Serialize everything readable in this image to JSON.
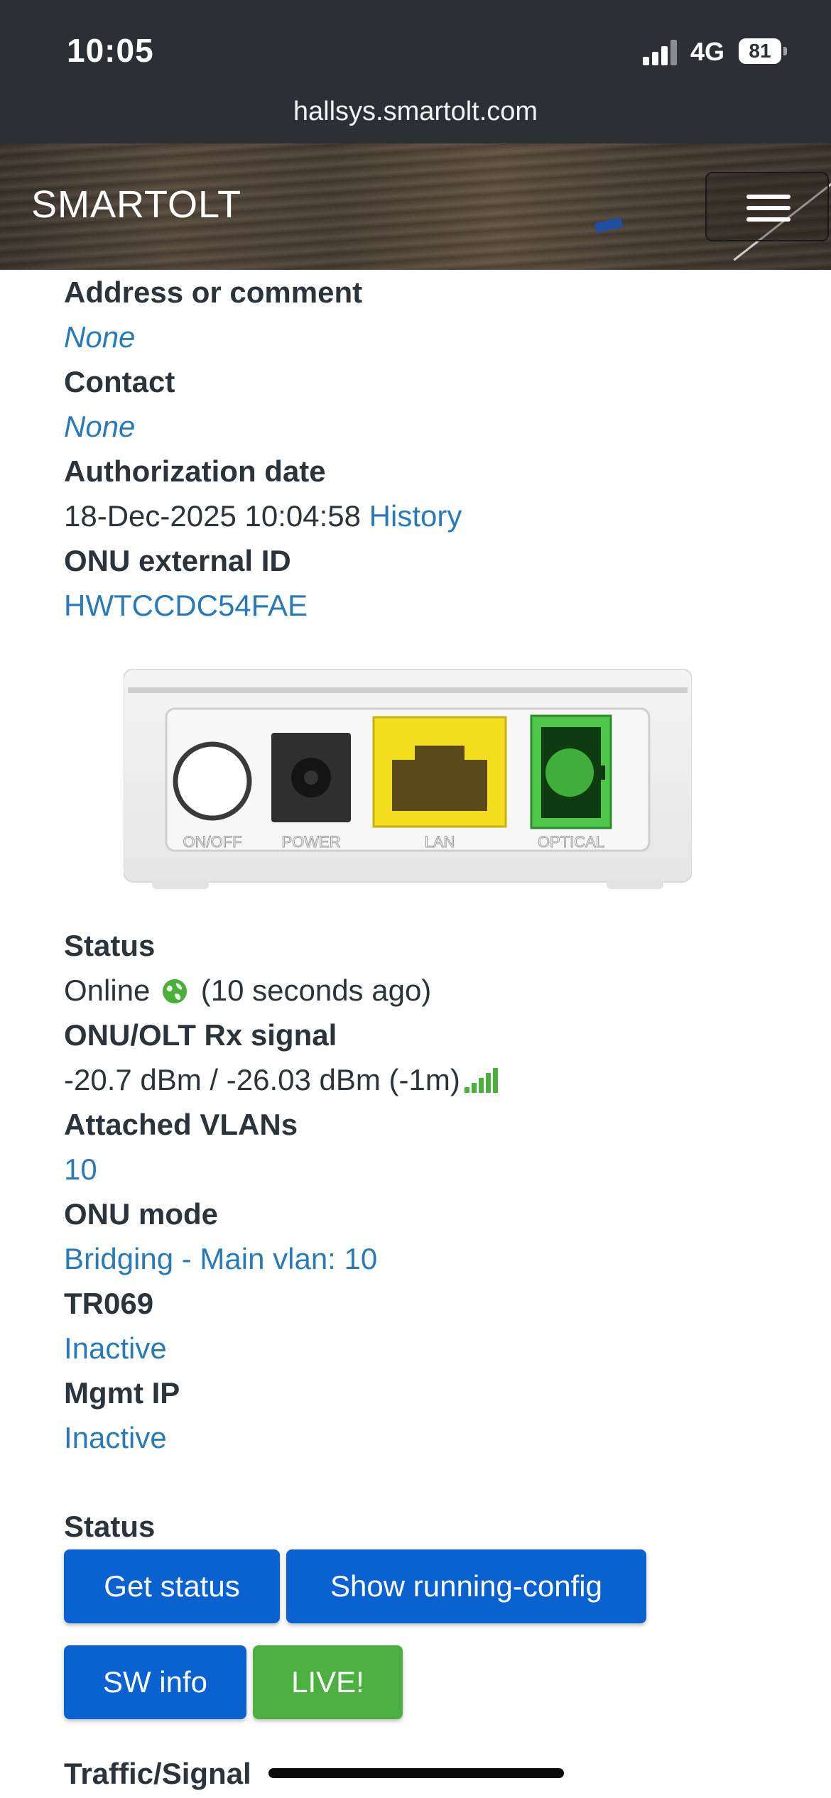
{
  "status_bar": {
    "time": "10:05",
    "network": "4G",
    "battery": "81"
  },
  "browser": {
    "url": "hallsys.smartolt.com"
  },
  "navbar": {
    "brand": "SMARTOLT",
    "menu_icon": "hamburger-menu-icon"
  },
  "details": {
    "address_label": "Address or comment",
    "address_value": "None",
    "contact_label": "Contact",
    "contact_value": "None",
    "auth_label": "Authorization date",
    "auth_value": "18-Dec-2025 10:04:58",
    "auth_history": "History",
    "ext_id_label": "ONU external ID",
    "ext_id_value": "HWTCCDC54FAE"
  },
  "device_image": {
    "ports": [
      "ON/OFF",
      "POWER",
      "LAN",
      "OPTICAL"
    ],
    "colors": {
      "lan": "#f3df1f",
      "optical": "#4ec64a"
    }
  },
  "status_info": {
    "status_label": "Status",
    "status_value": "Online",
    "status_icon": "globe-icon",
    "status_ago": "(10 seconds ago)",
    "signal_label": "ONU/OLT Rx signal",
    "signal_value": "-20.7 dBm / -26.03 dBm (-1m)",
    "signal_icon": "signal-bars-icon",
    "vlans_label": "Attached VLANs",
    "vlans_value": "10",
    "mode_label": "ONU mode",
    "mode_value": "Bridging - Main vlan: 10",
    "tr069_label": "TR069",
    "tr069_value": "Inactive",
    "mgmt_label": "Mgmt IP",
    "mgmt_value": "Inactive"
  },
  "actions": {
    "section_label": "Status",
    "get_status": "Get status",
    "show_running_config": "Show running-config",
    "sw_info": "SW info",
    "live": "LIVE!"
  },
  "traffic": {
    "label": "Traffic/Signal"
  },
  "colors": {
    "link": "#2a7ab8",
    "button_blue": "#0a62d0",
    "button_green": "#4cb040",
    "online": "#4caf3c"
  }
}
